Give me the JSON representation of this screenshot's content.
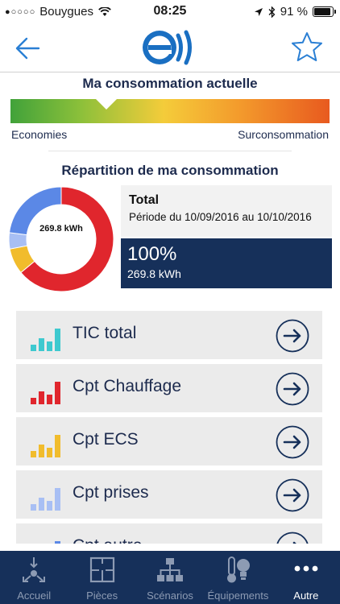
{
  "status_bar": {
    "carrier": "Bouygues",
    "signal_dots": "●○○○○",
    "time": "08:25",
    "battery": "91 %",
    "battery_level": 0.91
  },
  "nav": {
    "back_icon": "arrow-left-icon",
    "logo": "enedis-e-logo",
    "favorite_icon": "star-outline-icon"
  },
  "consumption": {
    "title": "Ma consommation actuelle",
    "left_label": "Economies",
    "right_label": "Surconsommation",
    "indicator_position": 0.3
  },
  "repartition": {
    "title": "Répartition de ma consommation",
    "donut_center": "269.8 kWh",
    "info_title": "Total",
    "info_period": "Période du 10/09/2016 au 10/10/2016",
    "percent": "100%",
    "total_kwh": "269.8 kWh",
    "segments": [
      {
        "label": "Cpt Chauffage",
        "fraction": 0.64,
        "color": "#e0262d"
      },
      {
        "label": "Cpt ECS",
        "fraction": 0.08,
        "color": "#f1bc2c"
      },
      {
        "label": "Cpt prises",
        "fraction": 0.05,
        "color": "#a8bff4"
      },
      {
        "label": "Cpt autre",
        "fraction": 0.23,
        "color": "#5b88e6"
      }
    ]
  },
  "list_items": [
    {
      "label": "TIC total",
      "color": "#3ec9cf",
      "icon": "bars-chart-icon"
    },
    {
      "label": "Cpt Chauffage",
      "color": "#e0262d",
      "icon": "bars-chart-icon"
    },
    {
      "label": "Cpt ECS",
      "color": "#f1bc2c",
      "icon": "bars-chart-icon"
    },
    {
      "label": "Cpt prises",
      "color": "#a8bff4",
      "icon": "bars-chart-icon"
    },
    {
      "label": "Cpt autre",
      "color": "#5b88e6",
      "icon": "bars-chart-icon"
    }
  ],
  "tabs": [
    {
      "label": "Accueil",
      "icon": "home-network-icon",
      "active": false
    },
    {
      "label": "Pièces",
      "icon": "floor-plan-icon",
      "active": false
    },
    {
      "label": "Scénarios",
      "icon": "scenario-tree-icon",
      "active": false
    },
    {
      "label": "Équipements",
      "icon": "thermometer-bulb-icon",
      "active": false
    },
    {
      "label": "Autre",
      "icon": "more-dots-icon",
      "active": true
    }
  ],
  "colors": {
    "navy": "#16305a",
    "title": "#1d2b4e",
    "accent_blue": "#2a7fd4"
  }
}
